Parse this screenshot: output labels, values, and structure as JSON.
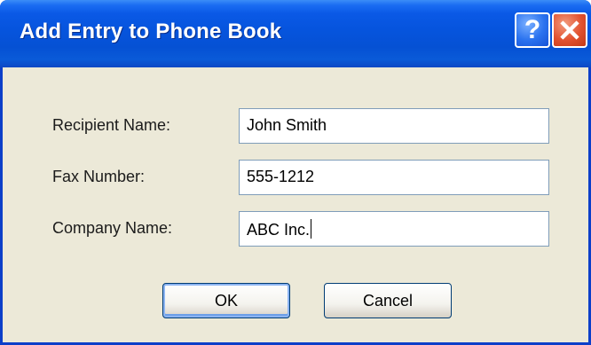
{
  "window": {
    "title": "Add Entry to Phone Book",
    "help_glyph": "?",
    "close_icon": "close-x-icon"
  },
  "form": {
    "recipient_label": "Recipient Name:",
    "recipient_value": "John Smith",
    "fax_label": "Fax Number:",
    "fax_value": "555-1212",
    "company_label": "Company Name:",
    "company_value": "ABC Inc."
  },
  "buttons": {
    "ok_label": "OK",
    "cancel_label": "Cancel"
  },
  "colors": {
    "titlebar_blue": "#0654dd",
    "dialog_background": "#ece9d8",
    "close_red": "#e2512f"
  }
}
